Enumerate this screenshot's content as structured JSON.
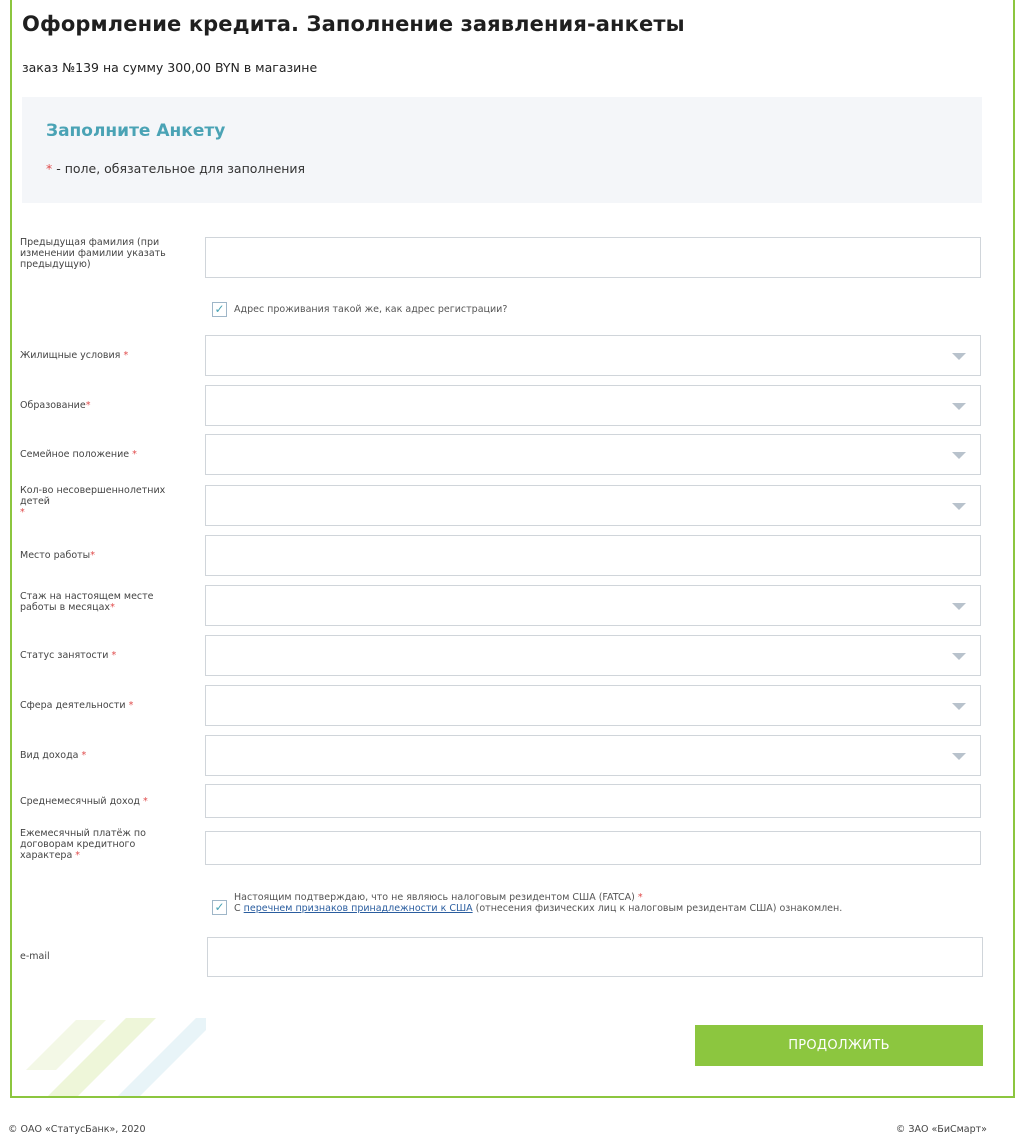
{
  "page": {
    "title": "Оформление кредита. Заполнение заявления-анкеты",
    "order_line": "заказ №139 на сумму 300,00 BYN в магазине"
  },
  "info": {
    "title": "Заполните Анкету",
    "required_mark": "*",
    "required_note": " - поле, обязательное для заполнения"
  },
  "fields": {
    "prev_surname_label": "Предыдущая фамилия (при изменении фамилии указать предыдущую)",
    "same_address_label": "Адрес проживания такой же, как адрес регистрации?",
    "same_address_checked": true,
    "housing_label": "Жилищные условия",
    "education_label": "Образование",
    "marital_label": "Семейное положение",
    "children_label": "Кол-во несовершеннолетних детей",
    "workplace_label": "Место работы",
    "tenure_label": "Стаж на настоящем месте работы в месяцах",
    "employment_label": "Статус занятости",
    "sphere_label": "Сфера деятельности",
    "income_type_label": "Вид дохода",
    "avg_income_label": "Среднемесячный доход",
    "monthly_payment_label": "Ежемесячный платёж по договорам кредитного характера",
    "email_label": "e-mail",
    "required_mark": "*"
  },
  "fatca": {
    "checked": true,
    "line1": "Настоящим подтверждаю, что не являюсь налоговым резидентом США (FATCA)",
    "line2_prefix": "С ",
    "link": "перечнем признаков принадлежности к США",
    "line2_suffix": " (отнесения физических лиц к налоговым резидентам США) ознакомлен."
  },
  "actions": {
    "continue_label": "ПРОДОЛЖИТЬ"
  },
  "footer": {
    "left": "© ОАО «СтатусБанк», 2020",
    "right": "© ЗАО «БиСмарт»"
  },
  "colors": {
    "accent": "#8cc63f",
    "heading": "#4aa3b5",
    "required": "#e04a4a"
  }
}
